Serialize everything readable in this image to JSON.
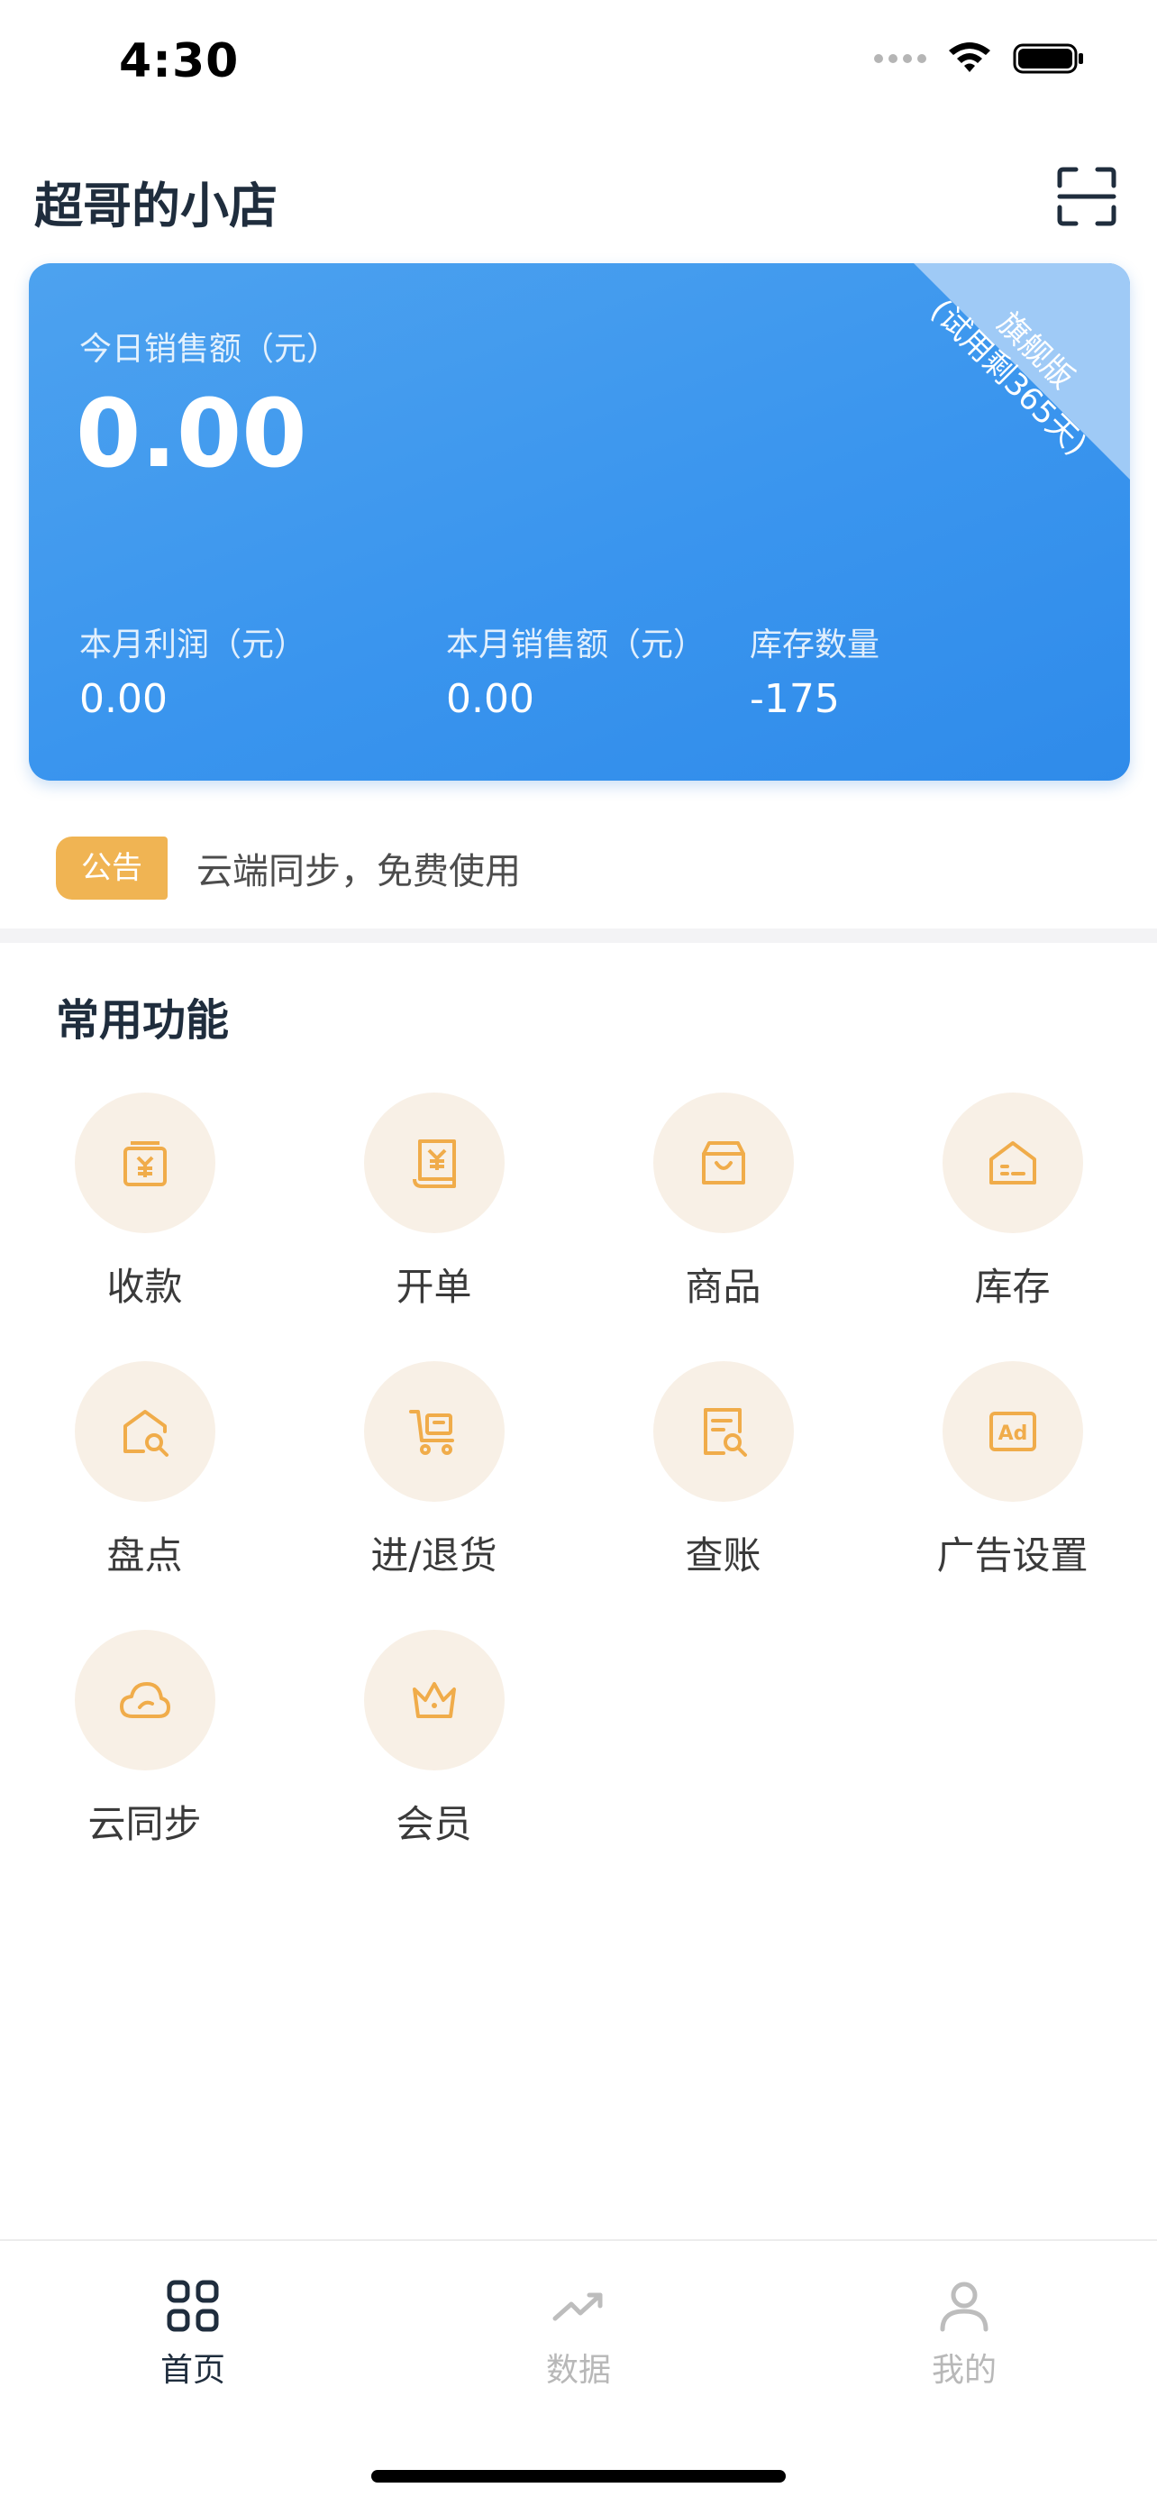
{
  "status_bar": {
    "time": "4:30"
  },
  "header": {
    "store_name": "超哥的小店",
    "scan_icon": "scan-icon"
  },
  "sales_card": {
    "ribbon_line1": "旗舰版",
    "ribbon_line2": "(试用剩365天)",
    "today_label": "今日销售额（元）",
    "today_value": "0.00",
    "stats": [
      {
        "label": "本月利润（元）",
        "value": "0.00"
      },
      {
        "label": "本月销售额（元）",
        "value": "0.00"
      },
      {
        "label": "库存数量",
        "value": "-175"
      }
    ],
    "colors": {
      "card": "#3a95ee",
      "ribbon": "#9fcaf6"
    }
  },
  "notice": {
    "badge": "公告",
    "text": "云端同步，免费使用",
    "badge_color": "#f0b453"
  },
  "functions": {
    "title": "常用功能",
    "accent_color": "#f0ac4a",
    "items": [
      {
        "label": "收款",
        "icon": "payment-icon"
      },
      {
        "label": "开单",
        "icon": "bill-icon"
      },
      {
        "label": "商品",
        "icon": "bag-icon"
      },
      {
        "label": "库存",
        "icon": "warehouse-icon"
      },
      {
        "label": "盘点",
        "icon": "house-search-icon"
      },
      {
        "label": "进/退货",
        "icon": "cart-icon"
      },
      {
        "label": "查账",
        "icon": "ledger-search-icon"
      },
      {
        "label": "广告设置",
        "icon": "ad-icon"
      },
      {
        "label": "云同步",
        "icon": "cloud-icon"
      },
      {
        "label": "会员",
        "icon": "crown-icon"
      }
    ]
  },
  "tab_bar": {
    "tabs": [
      {
        "label": "首页",
        "icon": "grid-icon",
        "active": true
      },
      {
        "label": "数据",
        "icon": "trend-icon",
        "active": false
      },
      {
        "label": "我的",
        "icon": "user-icon",
        "active": false
      }
    ]
  }
}
